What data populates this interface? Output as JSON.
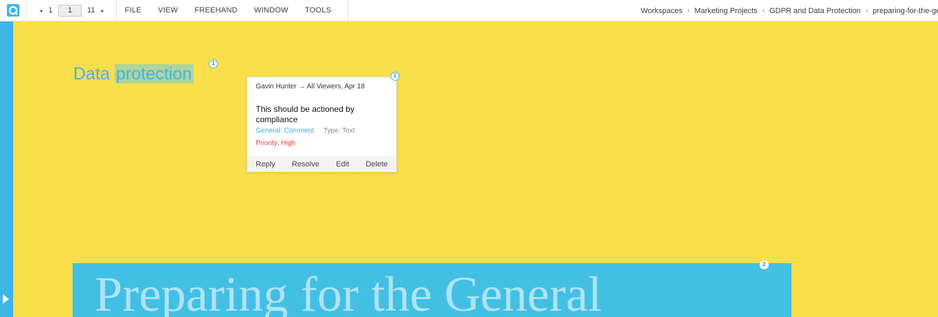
{
  "toolbar": {
    "logo_icon": "app-logo-icon",
    "pager": {
      "prev_icon": "◂",
      "current_page": "1",
      "page_input_value": "1",
      "total_pages": "11",
      "next_icon": "▸"
    },
    "menu": [
      "FILE",
      "VIEW",
      "FREEHAND",
      "WINDOW",
      "TOOLS"
    ]
  },
  "breadcrumb": {
    "items": [
      "Workspaces",
      "Marketing Projects",
      "GDPR and Data Protection",
      "preparing-for-the-ge"
    ],
    "separator": "›"
  },
  "document": {
    "heading_plain": "Data",
    "heading_highlight": "protection",
    "banner_text": "Preparing for the General"
  },
  "annotations": [
    {
      "number": "1",
      "label": "1"
    },
    {
      "number": "2",
      "label": "2"
    }
  ],
  "comment": {
    "meta": "Gavin Hunter → All Viewers, Apr 18",
    "text": "This should be actioned by compliance",
    "category": "General: Comment",
    "type": "Type: Text",
    "priority": "Priority: High",
    "badge": "1",
    "actions": [
      "Reply",
      "Resolve",
      "Edit",
      "Delete"
    ]
  },
  "colors": {
    "accent": "#3fb6e8",
    "canvas": "#f9df4c",
    "highlight": "#aed49a",
    "banner": "#42c0e4",
    "priority": "#e0423a"
  }
}
